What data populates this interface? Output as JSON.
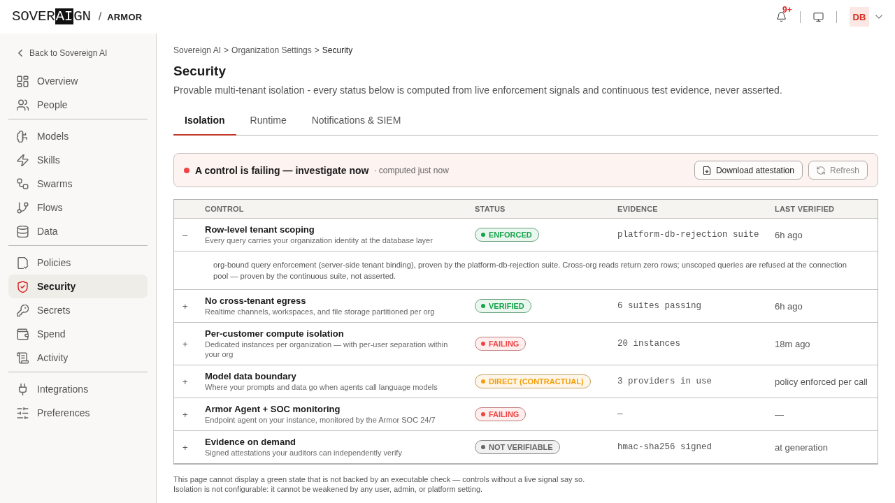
{
  "header": {
    "logo_parts": [
      {
        "text": "SOVER",
        "inverted": false
      },
      {
        "text": "AI",
        "inverted": true
      },
      {
        "text": "GN",
        "inverted": false
      }
    ],
    "separator": "/",
    "product": "ARMOR",
    "notification_badge": "9+",
    "avatar": "DB"
  },
  "sidebar": {
    "back_link": "Back to Sovereign AI",
    "groups": [
      {
        "items": [
          {
            "label": "Overview",
            "selected": false
          },
          {
            "label": "People",
            "selected": false
          }
        ]
      },
      {
        "items": [
          {
            "label": "Models",
            "selected": false
          },
          {
            "label": "Skills",
            "selected": false
          },
          {
            "label": "Swarms",
            "selected": false
          },
          {
            "label": "Flows",
            "selected": false
          },
          {
            "label": "Data",
            "selected": false
          }
        ]
      },
      {
        "items": [
          {
            "label": "Policies",
            "selected": false
          },
          {
            "label": "Security",
            "selected": true
          },
          {
            "label": "Secrets",
            "selected": false
          },
          {
            "label": "Spend",
            "selected": false
          },
          {
            "label": "Activity",
            "selected": false
          }
        ]
      },
      {
        "items": [
          {
            "label": "Integrations",
            "selected": false
          },
          {
            "label": "Preferences",
            "selected": false
          }
        ]
      }
    ]
  },
  "breadcrumb": [
    {
      "label": "Sovereign AI",
      "kind": "link"
    },
    {
      "label": ">",
      "kind": "separator"
    },
    {
      "label": "Organization Settings",
      "kind": "link"
    },
    {
      "label": ">",
      "kind": "separator"
    },
    {
      "label": "Security",
      "kind": "current"
    }
  ],
  "page": {
    "title": "Security",
    "subtitle": "Provable multi-tenant isolation - every status below is computed from live enforcement signals and continuous test evidence, never asserted."
  },
  "tabs": [
    {
      "label": "Isolation",
      "selected": true
    },
    {
      "label": "Runtime",
      "selected": false
    },
    {
      "label": "Notifications & SIEM",
      "selected": false
    }
  ],
  "alert": {
    "message": "A control is failing — investigate now",
    "meta": "· computed just now",
    "buttons": [
      {
        "label": "Download attestation",
        "kind": "download",
        "disabled": false
      },
      {
        "label": "Refresh",
        "kind": "refresh",
        "disabled": true
      }
    ]
  },
  "table": {
    "columns": [
      "CONTROL",
      "STATUS",
      "EVIDENCE",
      "LAST VERIFIED"
    ],
    "rows": [
      {
        "toggle": "–",
        "name": "Row-level tenant scoping",
        "description": "Every query carries your organization identity at the database layer",
        "status": {
          "label": "ENFORCED",
          "color": "#16a34a"
        },
        "evidence": "platform-db-rejection suite",
        "last_verified": "6h ago",
        "detail": "org-bound query enforcement (server-side tenant binding), proven by the platform-db-rejection suite. Cross-org reads return zero rows; unscoped queries are refused at the connection pool — proven by the continuous suite, not asserted."
      },
      {
        "toggle": "+",
        "name": "No cross-tenant egress",
        "description": "Realtime channels, workspaces, and file storage partitioned per org",
        "status": {
          "label": "VERIFIED",
          "color": "#16a34a"
        },
        "evidence": "6 suites passing",
        "last_verified": "6h ago"
      },
      {
        "toggle": "+",
        "name": "Per-customer compute isolation",
        "description": "Dedicated instances per organization — with per-user separation within your org",
        "status": {
          "label": "FAILING",
          "color": "#ef4444"
        },
        "evidence": "20 instances",
        "last_verified": "18m ago"
      },
      {
        "toggle": "+",
        "name": "Model data boundary",
        "description": "Where your prompts and data go when agents call language models",
        "status": {
          "label": "DIRECT (CONTRACTUAL)",
          "color": "#f59e0b"
        },
        "evidence": "3 providers in use",
        "last_verified": "policy enforced per call"
      },
      {
        "toggle": "+",
        "name": "Armor Agent + SOC monitoring",
        "description": "Endpoint agent on your instance, monitored by the Armor SOC 24/7",
        "status": {
          "label": "FAILING",
          "color": "#ef4444"
        },
        "evidence": "—",
        "last_verified": "—"
      },
      {
        "toggle": "+",
        "name": "Evidence on demand",
        "description": "Signed attestations your auditors can independently verify",
        "status": {
          "label": "NOT VERIFIABLE",
          "color": "#666666"
        },
        "evidence": "hmac-sha256 signed",
        "last_verified": "at generation"
      }
    ]
  },
  "footnotes": [
    "This page cannot display a green state that is not backed by an executable check — controls without a live signal say so.",
    "Isolation is not configurable: it cannot be weakened by any user, admin, or platform setting."
  ]
}
